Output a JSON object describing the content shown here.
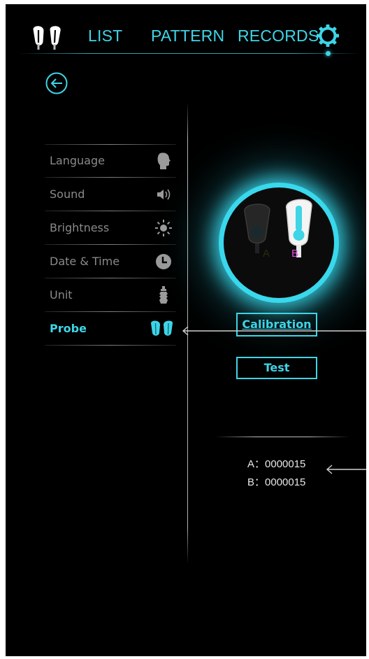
{
  "nav": {
    "list": "LIST",
    "pattern": "PATTERN",
    "records": "RECORDS",
    "logo_icon": "probe-pair-icon",
    "settings_icon": "gear-icon"
  },
  "back_icon": "back-arrow-icon",
  "menu": {
    "items": [
      {
        "label": "Language",
        "icon": "head-profile-icon",
        "active": false
      },
      {
        "label": "Sound",
        "icon": "speaker-icon",
        "active": false
      },
      {
        "label": "Brightness",
        "icon": "sun-icon",
        "active": false
      },
      {
        "label": "Date & Time",
        "icon": "clock-icon",
        "active": false
      },
      {
        "label": "Unit",
        "icon": "bottle-icon",
        "active": false
      },
      {
        "label": "Probe",
        "icon": "probe-pair-icon",
        "active": true
      }
    ]
  },
  "probe": {
    "label_a": "A",
    "label_b": "B"
  },
  "buttons": {
    "calibration": "Calibration",
    "test": "Test"
  },
  "serials": {
    "a": "A：0000015",
    "b": "B：0000015"
  },
  "colors": {
    "accent": "#3fd4e6",
    "probe_b_label": "#e24ce0",
    "background": "#000000"
  }
}
